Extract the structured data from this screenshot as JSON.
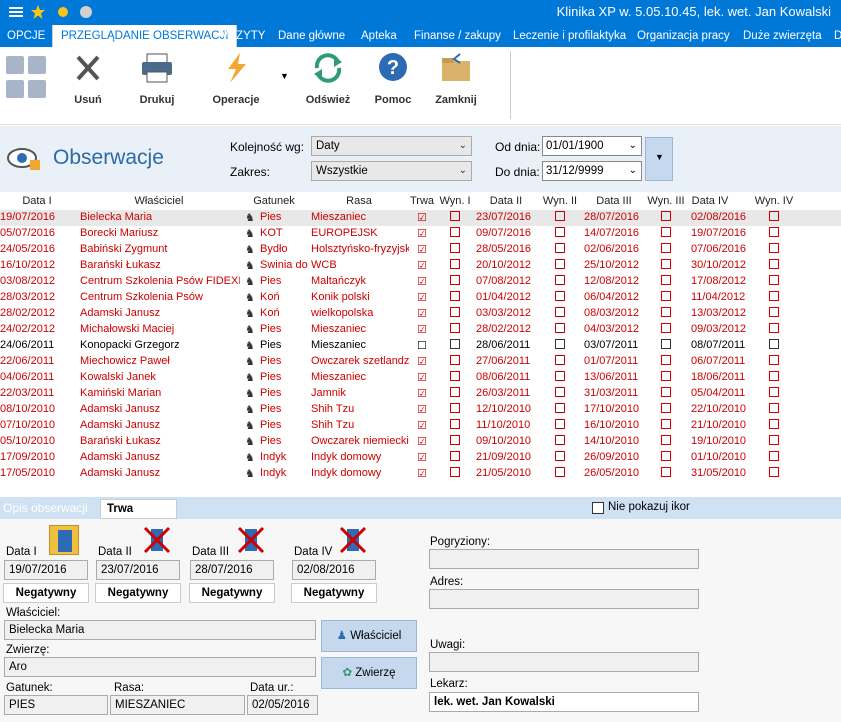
{
  "titlebar": {
    "title": "Klinika XP w. 5.05.10.45, lek. wet. Jan Kowalski"
  },
  "tabs": [
    {
      "label": "OPCJE"
    },
    {
      "label": "PRZEGLĄDANIE OBSERWACJI"
    },
    {
      "label": "WIZYTY"
    },
    {
      "label": "Dane główne"
    },
    {
      "label": "Apteka"
    },
    {
      "label": "Finanse / zakupy"
    },
    {
      "label": "Leczenie i profilaktyka"
    },
    {
      "label": "Organizacja pracy"
    },
    {
      "label": "Duże zwierzęta"
    },
    {
      "label": "D"
    }
  ],
  "ribbon": {
    "buttons": [
      {
        "label": "Usuń",
        "icon": "x-icon"
      },
      {
        "label": "Drukuj",
        "icon": "printer-icon"
      },
      {
        "label": "Operacje",
        "icon": "lightning-icon"
      },
      {
        "label": "Odśwież",
        "icon": "refresh-icon"
      },
      {
        "label": "Pomoc",
        "icon": "help-icon"
      },
      {
        "label": "Zamknij",
        "icon": "folder-close-icon"
      }
    ]
  },
  "header": {
    "page_title": "Obserwacje",
    "kolejnosc_label": "Kolejność wg:",
    "kolejnosc_value": "Daty",
    "zakres_label": "Zakres:",
    "zakres_value": "Wszystkie",
    "od_label": "Od dnia:",
    "od_value": "01/01/1900",
    "do_label": "Do dnia:",
    "do_value": "31/12/9999"
  },
  "grid": {
    "columns": [
      "Data I",
      "Właściciel",
      "Gatunek",
      "Rasa",
      "Trwa",
      "Wyn. I",
      "Data II",
      "Wyn. II",
      "Data III",
      "Wyn. III",
      "Data IV",
      "Wyn. IV"
    ],
    "rows": [
      {
        "d1": "19/07/2016",
        "owner": "Bielecka Maria",
        "species": "Pies",
        "breed": "Mieszaniec",
        "trwa": "☑",
        "d2": "23/07/2016",
        "d3": "28/07/2016",
        "d4": "02/08/2016",
        "red": true
      },
      {
        "d1": "05/07/2016",
        "owner": "Borecki  Mariusz",
        "species": "KOT",
        "breed": " EUROPEJSK",
        "trwa": "☑",
        "d2": "09/07/2016",
        "d3": "14/07/2016",
        "d4": "19/07/2016",
        "red": true
      },
      {
        "d1": "24/05/2016",
        "owner": "Babiński Zygmunt",
        "species": "Bydło",
        "breed": "Holsztyńsko-fryzyjsk",
        "trwa": "☑",
        "d2": "28/05/2016",
        "d3": "02/06/2016",
        "d4": "07/06/2016",
        "red": true
      },
      {
        "d1": "16/10/2012",
        "owner": "Barański Łukasz",
        "species": "Świnia dor",
        "breed": "WCB",
        "trwa": "☑",
        "d2": "20/10/2012",
        "d3": "25/10/2012",
        "d4": "30/10/2012",
        "red": true
      },
      {
        "d1": "03/08/2012",
        "owner": "Centrum Szkolenia Psów FIDEXIT",
        "species": "Pies",
        "breed": "Maltańczyk",
        "trwa": "☑",
        "d2": "07/08/2012",
        "d3": "12/08/2012",
        "d4": "17/08/2012",
        "red": true
      },
      {
        "d1": "28/03/2012",
        "owner": "Centrum Szkolenia Psów",
        "species": "Koń",
        "breed": "Konik polski",
        "trwa": "☑",
        "d2": "01/04/2012",
        "d3": "06/04/2012",
        "d4": "11/04/2012",
        "red": true
      },
      {
        "d1": "28/02/2012",
        "owner": "Adamski Janusz",
        "species": "Koń",
        "breed": "wielkopolska",
        "trwa": "☑",
        "d2": "03/03/2012",
        "d3": "08/03/2012",
        "d4": "13/03/2012",
        "red": true
      },
      {
        "d1": "24/02/2012",
        "owner": "Michałowski Maciej",
        "species": "Pies",
        "breed": "Mieszaniec",
        "trwa": "☑",
        "d2": "28/02/2012",
        "d3": "04/03/2012",
        "d4": "09/03/2012",
        "red": true
      },
      {
        "d1": "24/06/2011",
        "owner": "Konopacki Grzegorz",
        "species": "Pies",
        "breed": "Mieszaniec",
        "trwa": "☐",
        "d2": "28/06/2011",
        "d3": "03/07/2011",
        "d4": "08/07/2011",
        "red": false
      },
      {
        "d1": "22/06/2011",
        "owner": "Miechowicz Paweł",
        "species": "Pies",
        "breed": "Owczarek szetlandzk",
        "trwa": "☑",
        "d2": "27/06/2011",
        "d3": "01/07/2011",
        "d4": "06/07/2011",
        "red": true
      },
      {
        "d1": "04/06/2011",
        "owner": "Kowalski Janek",
        "species": "Pies",
        "breed": "Mieszaniec",
        "trwa": "☑",
        "d2": "08/06/2011",
        "d3": "13/06/2011",
        "d4": "18/06/2011",
        "red": true
      },
      {
        "d1": "22/03/2011",
        "owner": "Kamiński Marian",
        "species": "Pies",
        "breed": "Jamnik",
        "trwa": "☑",
        "d2": "26/03/2011",
        "d3": "31/03/2011",
        "d4": "05/04/2011",
        "red": true
      },
      {
        "d1": "08/10/2010",
        "owner": "Adamski Janusz",
        "species": "Pies",
        "breed": "Shih Tzu",
        "trwa": "☑",
        "d2": "12/10/2010",
        "d3": "17/10/2010",
        "d4": "22/10/2010",
        "red": true
      },
      {
        "d1": "07/10/2010",
        "owner": "Adamski Janusz",
        "species": "Pies",
        "breed": "Shih Tzu",
        "trwa": "☑",
        "d2": "11/10/2010",
        "d3": "16/10/2010",
        "d4": "21/10/2010",
        "red": true
      },
      {
        "d1": "05/10/2010",
        "owner": "Barański Łukasz",
        "species": "Pies",
        "breed": "Owczarek niemiecki",
        "trwa": "☑",
        "d2": "09/10/2010",
        "d3": "14/10/2010",
        "d4": "19/10/2010",
        "red": true
      },
      {
        "d1": "17/09/2010",
        "owner": "Adamski Janusz",
        "species": "Indyk",
        "breed": "Indyk domowy",
        "trwa": "☑",
        "d2": "21/09/2010",
        "d3": "26/09/2010",
        "d4": "01/10/2010",
        "red": true
      },
      {
        "d1": "17/05/2010",
        "owner": "Adamski Janusz",
        "species": "Indyk",
        "breed": "Indyk domowy",
        "trwa": "☑",
        "d2": "21/05/2010",
        "d3": "26/05/2010",
        "d4": "31/05/2010",
        "red": true
      }
    ]
  },
  "detail": {
    "opis_label": "Opis obserwacji",
    "opis_value": "Trwa",
    "nie_pokazuj": "Nie pokazuj ikor",
    "dates": [
      {
        "label": "Data I",
        "value": "19/07/2016",
        "result": "Negatywny"
      },
      {
        "label": "Data II",
        "value": "23/07/2016",
        "result": "Negatywny"
      },
      {
        "label": "Data III",
        "value": "28/07/2016",
        "result": "Negatywny"
      },
      {
        "label": "Data IV",
        "value": "02/08/2016",
        "result": "Negatywny"
      }
    ],
    "wlasciciel_label": "Właściciel:",
    "wlasciciel_value": "Bielecka Maria",
    "zwierze_label": "Zwierzę:",
    "zwierze_value": "Aro",
    "gatunek_label": "Gatunek:",
    "gatunek_value": "PIES",
    "rasa_label": "Rasa:",
    "rasa_value": "MIESZANIEC",
    "dataur_label": "Data ur.:",
    "dataur_value": "02/05/2016",
    "btn_wlasciciel": "Właściciel",
    "btn_zwierze": "Zwierzę",
    "pogryziony_label": "Pogryziony:",
    "pogryziony_value": "",
    "adres_label": "Adres:",
    "adres_value": "",
    "uwagi_label": "Uwagi:",
    "uwagi_value": "",
    "lekarz_label": "Lekarz:",
    "lekarz_value": "lek. wet. Jan Kowalski"
  }
}
